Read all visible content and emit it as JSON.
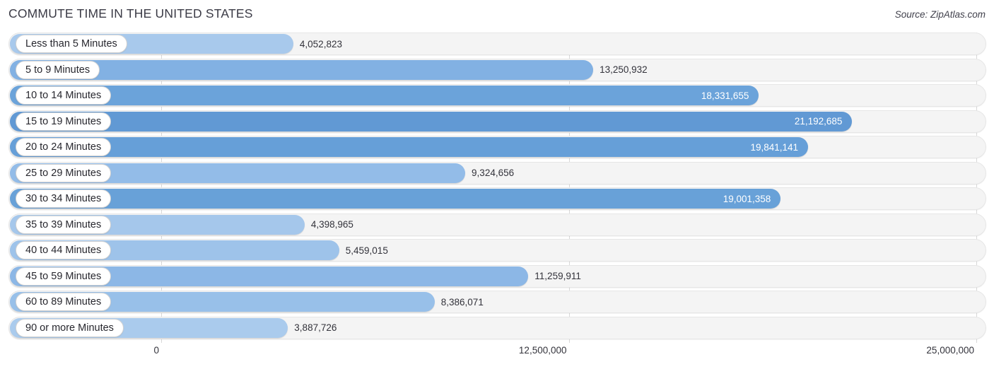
{
  "header": {
    "title": "COMMUTE TIME IN THE UNITED STATES",
    "source": "Source: ZipAtlas.com"
  },
  "chart_data": {
    "type": "bar",
    "orientation": "horizontal",
    "title": "COMMUTE TIME IN THE UNITED STATES",
    "xlabel": "",
    "ylabel": "",
    "xlim": [
      0,
      25000000
    ],
    "grid": true,
    "legend": "none",
    "axis_ticks": [
      "0",
      "12,500,000",
      "25,000,000"
    ],
    "axis_tick_values": [
      0,
      12500000,
      25000000
    ],
    "categories": [
      "Less than 5 Minutes",
      "5 to 9 Minutes",
      "10 to 14 Minutes",
      "15 to 19 Minutes",
      "20 to 24 Minutes",
      "25 to 29 Minutes",
      "30 to 34 Minutes",
      "35 to 39 Minutes",
      "40 to 44 Minutes",
      "45 to 59 Minutes",
      "60 to 89 Minutes",
      "90 or more Minutes"
    ],
    "values": [
      4052823,
      13250932,
      18331655,
      21192685,
      19841141,
      9324656,
      19001358,
      4398965,
      5459015,
      11259911,
      8386071,
      3887726
    ],
    "value_labels": [
      "4,052,823",
      "13,250,932",
      "18,331,655",
      "21,192,685",
      "19,841,141",
      "9,324,656",
      "19,001,358",
      "4,398,965",
      "5,459,015",
      "11,259,911",
      "8,386,071",
      "3,887,726"
    ],
    "label_placement": [
      "outside",
      "outside",
      "inside",
      "inside",
      "inside",
      "outside",
      "inside",
      "outside",
      "outside",
      "outside",
      "outside",
      "outside"
    ],
    "bar_colors": [
      "#a8c9ec",
      "#82b1e3",
      "#6ba3da",
      "#6199d4",
      "#669fd8",
      "#93bce8",
      "#68a1d8",
      "#a5c7eb",
      "#9ec3ea",
      "#8cb7e6",
      "#98c0e9",
      "#aacbed"
    ]
  },
  "colors": {
    "track": "#f4f4f4",
    "track_border": "#e6e6e6",
    "gridline": "#d8d8d8",
    "text": "#33333b",
    "title": "#3b3b46"
  }
}
